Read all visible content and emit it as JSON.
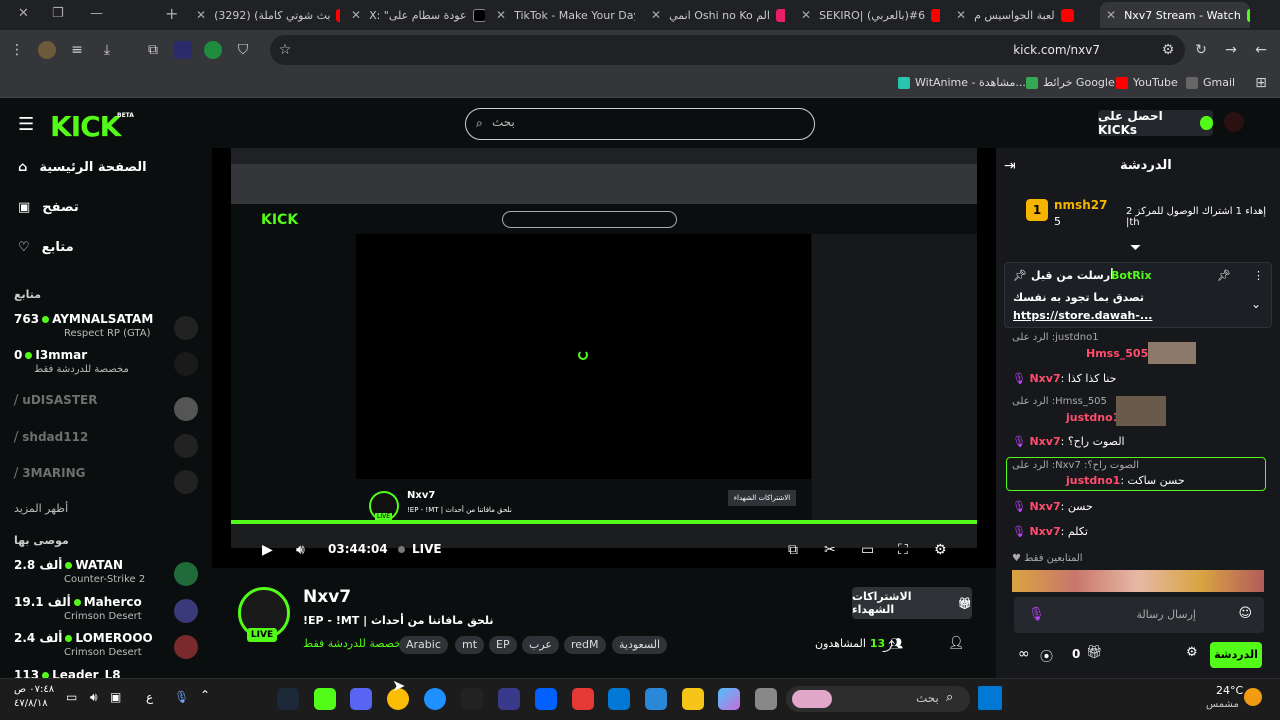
{
  "browser": {
    "tabs": [
      {
        "label": "(3292) (بث شوتي كاملة",
        "color": "#ff0000"
      },
      {
        "label": "X: \"عودة سطام على",
        "color": "#ffffff"
      },
      {
        "label": "TikTok - Make Your Day",
        "color": "#ffffff"
      },
      {
        "label": "انمي Oshi no Ko الم",
        "color": "#e91e63"
      },
      {
        "label": "SEKIRO| (بالعربي)#6",
        "color": "#ff0000"
      },
      {
        "label": "لعبة الجواسيس م",
        "color": "#ff0000"
      },
      {
        "label": "Nxv7 Stream - Watch",
        "color": "#53fc18"
      }
    ],
    "url": "kick.com/nxv7",
    "bookmarks": [
      {
        "label": "Gmail",
        "color": "#666"
      },
      {
        "label": "YouTube",
        "color": "#ff0000"
      },
      {
        "label": "خرائط Google",
        "color": "#34a853"
      },
      {
        "label": "WitAnime - مشاهدة...",
        "color": "#27c4b0"
      }
    ]
  },
  "kick": {
    "logo": "KICK",
    "beta": "BETA",
    "search_placeholder": "بحث",
    "get_kicks": "احصل على KICKs"
  },
  "sidebar": {
    "nav": [
      {
        "label": "الصفحة الرئيسية",
        "icon": "home-icon"
      },
      {
        "label": "تصفح",
        "icon": "browse-icon"
      },
      {
        "label": "متابع",
        "icon": "heart-icon"
      }
    ],
    "following_title": "متابع",
    "following": [
      {
        "viewers": "763",
        "name": "AYMNALSATAM",
        "sub": "Respect RP (GTA)",
        "live": true
      },
      {
        "viewers": "0",
        "name": "I3mmar",
        "sub": "مخصصة للدردشة فقط",
        "live": true
      },
      {
        "viewers": "",
        "name": "uDISASTER",
        "sub": "",
        "live": false
      },
      {
        "viewers": "",
        "name": "shdad112",
        "sub": "",
        "live": false
      },
      {
        "viewers": "",
        "name": "3MARING",
        "sub": "",
        "live": false
      }
    ],
    "show_more": "أظهر المزيد",
    "recommended_title": "موصى بها",
    "recommended": [
      {
        "viewers": "2.8 ألف",
        "name": "WATAN",
        "sub": "Counter-Strike 2"
      },
      {
        "viewers": "19.1 ألف",
        "name": "Maherco",
        "sub": "Crimson Desert"
      },
      {
        "viewers": "2.4 ألف",
        "name": "LOMEROOO",
        "sub": "Crimson Desert"
      },
      {
        "viewers": "113",
        "name": "Leader_L8",
        "sub": ""
      }
    ]
  },
  "player": {
    "timecode": "03:44:04",
    "live": "LIVE",
    "inner_live_label": "LIVE",
    "inner_streamer": "Nxv7",
    "inner_title": "!EP - !MT | نلحق مافاتنا من أحداث",
    "inner_subs_btn": "الاشتراكات الشهداء"
  },
  "stream": {
    "name": "Nxv7",
    "title": "!EP - !MT | نلحق مافاتنا من أحداث",
    "category": "مخصصة للدردشة فقط",
    "tags": [
      "Arabic",
      "mt",
      "EP",
      "عرب",
      "redM",
      "السعودية"
    ],
    "live": "LIVE",
    "subs_button": "الاشتراكات الشهداء",
    "viewers_label": "المشاهدون",
    "viewers": "13"
  },
  "chat": {
    "title": "الدردشة",
    "gifter": {
      "name": "nmsh27",
      "count": "5",
      "text": "إهداء 1 اشتراك الوصول للمركز 2 |th"
    },
    "pinned": {
      "label": "أرسلت من قبل",
      "user": "BotRix",
      "text": "تصدق بما تجود به نفسك",
      "link": "https://store.dawah-..."
    },
    "messages": [
      {
        "reply": "الرد على :justdno1",
        "user": "Hmss_505",
        "text": ""
      },
      {
        "reply": "",
        "user": "Nxv7",
        "text": "حنا كذا كذا"
      },
      {
        "reply": "الرد على :Hmss_505",
        "user": "justdno1",
        "text": ""
      },
      {
        "reply": "",
        "user": "Nxv7",
        "text": "الصوت راح؟"
      },
      {
        "reply": "الرد على :Nxv7 :الصوت راح؟",
        "user": "justdno1",
        "text": "حسن ساكت"
      },
      {
        "reply": "",
        "user": "Nxv7",
        "text": "حسن"
      },
      {
        "reply": "",
        "user": "Nxv7",
        "text": "تكلم"
      }
    ],
    "followers_only": "المتابعين فقط",
    "input_placeholder": "إرسال رسالة",
    "count": "0",
    "send": "الدردشة"
  },
  "taskbar": {
    "search": "بحث",
    "weather_temp": "24°C",
    "weather_desc": "مشمس",
    "time": "٠٧:٤٨ ص",
    "date": "٤٧/٨/١٨",
    "lang": "ع"
  }
}
